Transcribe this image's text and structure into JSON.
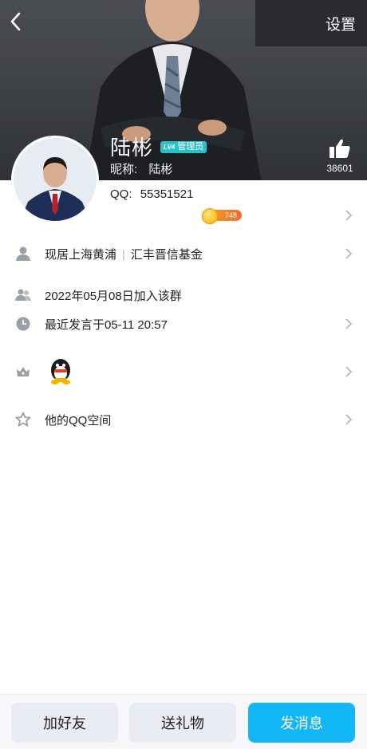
{
  "header": {
    "settings_label": "设置",
    "name": "陆彬",
    "badge_level": "LV4",
    "badge_role": "管理员",
    "nickname_label": "昵称:",
    "nickname_value": "陆彬",
    "likes": "38601"
  },
  "profile": {
    "qq_label": "QQ:",
    "qq_number": "55351521",
    "coin_value": "748"
  },
  "details": {
    "location": "现居上海黄浦",
    "separator": "|",
    "company": "汇丰晋信基金",
    "join_date": "2022年05月08日加入该群",
    "last_post": "最近发言于05-11 20:57",
    "qzone": "他的QQ空间"
  },
  "actions": {
    "add_friend": "加好友",
    "send_gift": "送礼物",
    "send_message": "发消息"
  },
  "colors": {
    "accent": "#12b7f5",
    "badge": "#2ac2c8",
    "coin": "#f4b400"
  }
}
